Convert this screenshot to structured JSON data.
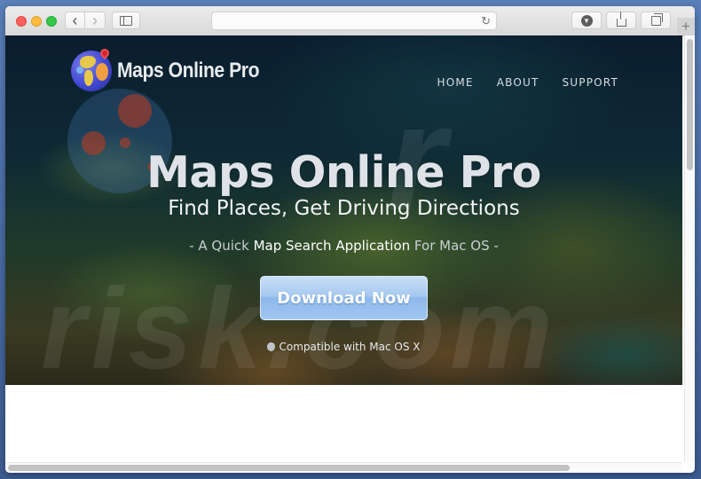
{
  "browser": {
    "url": "",
    "new_tab_label": "+",
    "icons": {
      "back": "chevron-left-icon",
      "forward": "chevron-right-icon",
      "sidebar": "sidebar-icon",
      "reload": "reload-icon",
      "downloads": "download-icon",
      "share": "share-icon",
      "tabs": "tabs-overview-icon"
    },
    "glyphs": {
      "back": "‹",
      "forward": "›",
      "reload": "↻",
      "downloads": "⬇",
      "share": "⇪",
      "tabs": "❐"
    }
  },
  "site": {
    "logo_text": "Maps Online Pro",
    "nav": [
      {
        "label": "HOME"
      },
      {
        "label": "ABOUT"
      },
      {
        "label": "SUPPORT"
      }
    ],
    "hero": {
      "title": "Maps Online Pro",
      "subtitle": "Find Places, Get Driving Directions",
      "tagline": {
        "part1": "- A Quick ",
        "part2": "Map Search Application",
        "part3": " For Mac OS -"
      },
      "cta_label": "Download Now",
      "compat_text": "Compatible with Mac OS X"
    },
    "watermark_text": "risk.com"
  },
  "colors": {
    "button_top": "#c9dff7",
    "button_bottom": "#8cb8ea",
    "desktop": "#4a6da7"
  }
}
